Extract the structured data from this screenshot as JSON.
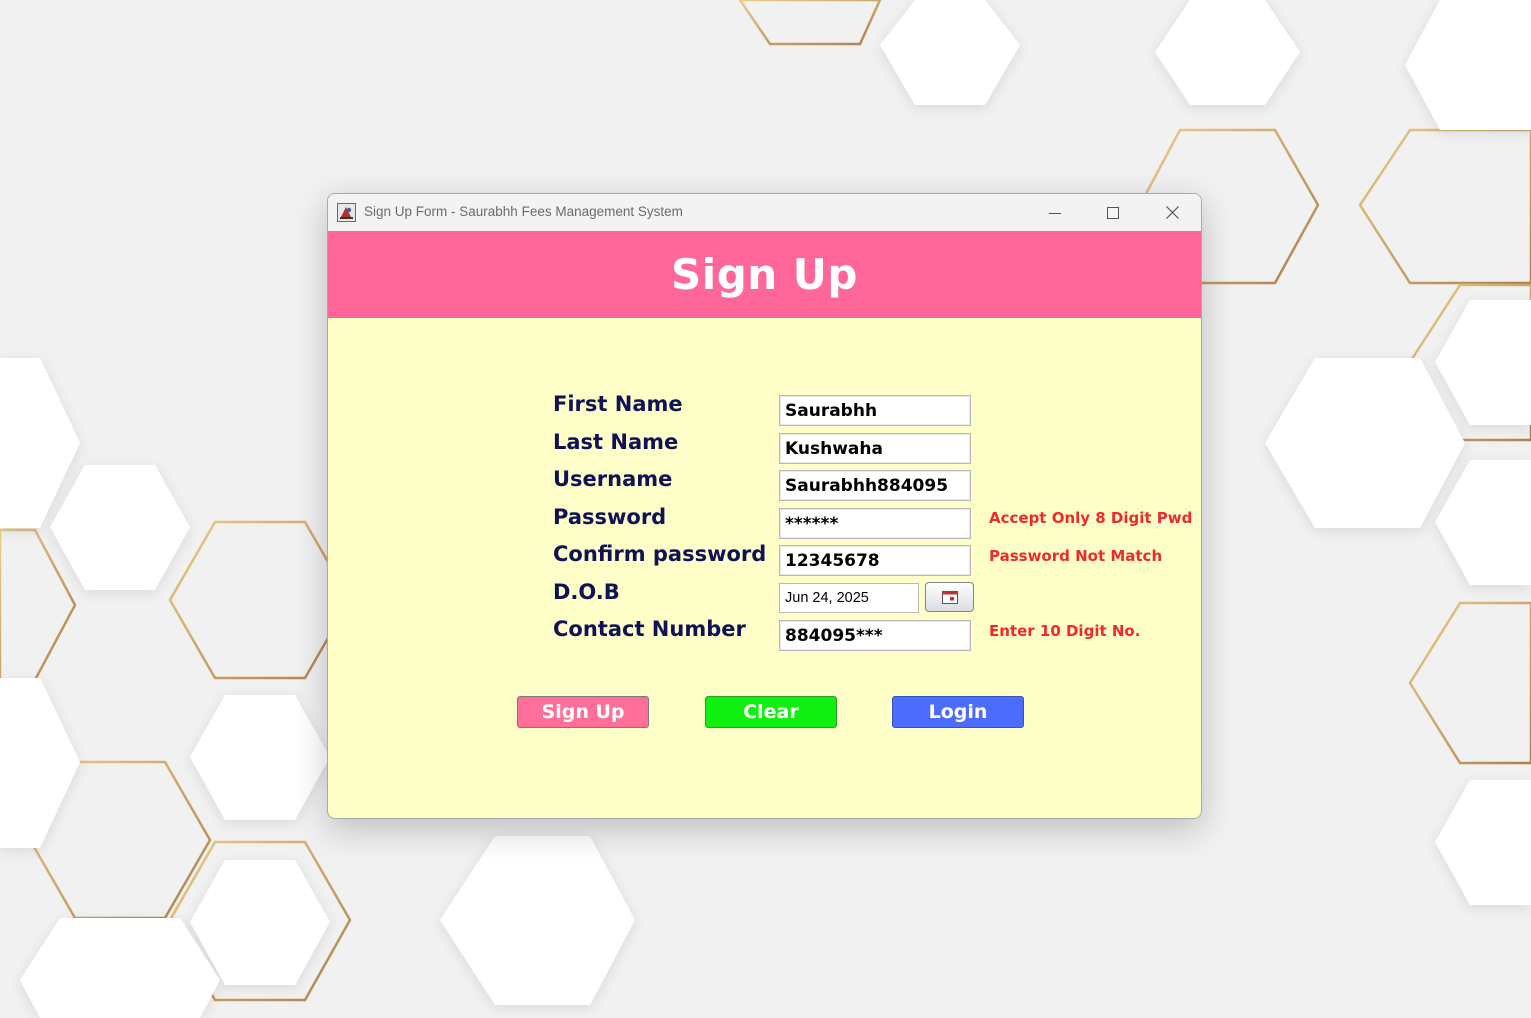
{
  "window": {
    "title": "Sign Up Form - Saurabhh Fees Management System",
    "controls": {
      "minimize_icon": "minimize-icon",
      "maximize_icon": "maximize-icon",
      "close_icon": "close-icon"
    }
  },
  "header": {
    "title": "Sign Up",
    "background": "#ff6699"
  },
  "form": {
    "fields": {
      "first_name": {
        "label": "First Name",
        "value": "Saurabhh"
      },
      "last_name": {
        "label": "Last Name",
        "value": "Kushwaha"
      },
      "username": {
        "label": "Username",
        "value": "Saurabhh884095"
      },
      "password": {
        "label": "Password",
        "value": "******",
        "error": "Accept Only 8 Digit Pwd"
      },
      "confirm_password": {
        "label": "Confirm password",
        "value": "12345678",
        "error": "Password Not Match"
      },
      "dob": {
        "label": "D.O.B",
        "value": "Jun 24, 2025",
        "picker_icon": "calendar-icon"
      },
      "contact": {
        "label": "Contact Number",
        "value": "884095***",
        "error": "Enter 10 Digit No."
      }
    },
    "buttons": {
      "sign_up": {
        "label": "Sign Up",
        "color": "#ff6f9a"
      },
      "clear": {
        "label": "Clear",
        "color": "#10f010"
      },
      "login": {
        "label": "Login",
        "color": "#4c6cfb"
      }
    }
  },
  "colors": {
    "form_background": "#fefec8",
    "label_color": "#0f1257",
    "error_color": "#ee2b2b"
  }
}
